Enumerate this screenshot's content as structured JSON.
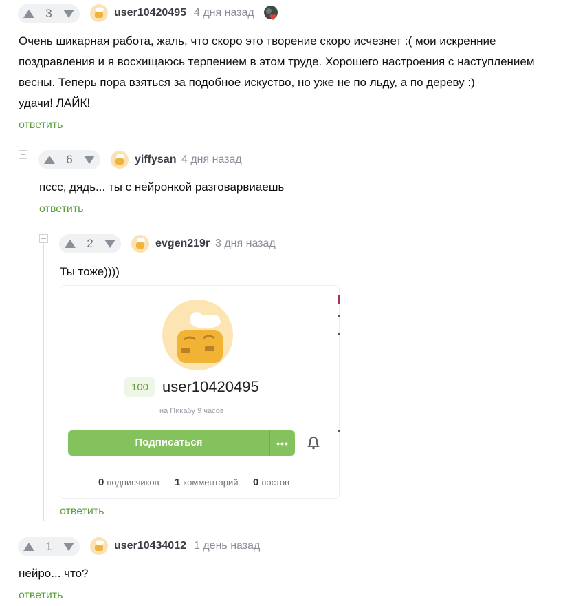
{
  "comments": [
    {
      "votes": "3",
      "username": "user10420495",
      "time": "4 дня назад",
      "lines": [
        "Очень шикарная работа, жаль, что скоро это творение скоро исчезнет :( мои искренние",
        "поздравления и я восхищаюсь терпением в этом труде. Хорошего настроения с наступлением",
        "весны. Теперь пора взяться за подобное искуство, но уже не по льду, а по дереву :)",
        "удачи! ЛАЙК!"
      ],
      "reply_label": "ответить"
    },
    {
      "votes": "6",
      "username": "yiffysan",
      "time": "4 дня назад",
      "text": "пссс, дядь... ты с нейронкой разговарвиаешь",
      "reply_label": "ответить"
    },
    {
      "votes": "2",
      "username": "evgen219r",
      "time": "3 дня назад",
      "text": "Ты тоже))))",
      "reply_label": "ответить"
    },
    {
      "votes": "1",
      "username": "user10434012",
      "time": "1 день назад",
      "text": "нейро... что?",
      "reply_label": "ответить"
    }
  ],
  "profile_card": {
    "rating": "100",
    "username": "user10420495",
    "subtitle": "на Пикабу 9 часов",
    "subscribe_label": "Подписаться",
    "more_label": "•••",
    "stats": {
      "subscribers_count": "0",
      "subscribers_label": "подписчиков",
      "comments_count": "1",
      "comments_label": "комментарий",
      "posts_count": "0",
      "posts_label": "постов"
    }
  },
  "colors": {
    "accent_green": "#83c25c",
    "reply_green": "#5b9e3a",
    "muted_gray": "#8a8f99"
  }
}
